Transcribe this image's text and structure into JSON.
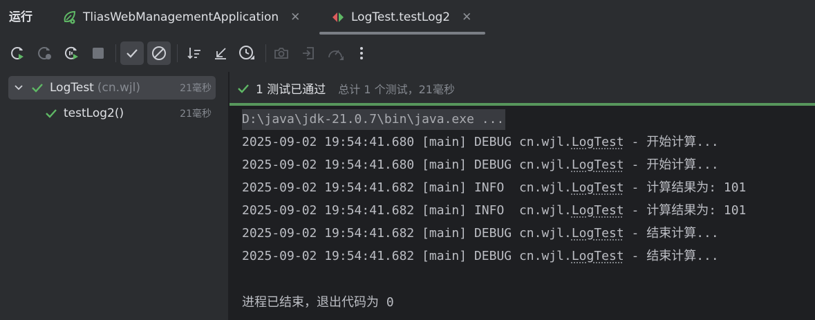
{
  "header": {
    "tool_title": "运行",
    "tabs": [
      {
        "label": "TliasWebManagementApplication",
        "icon": "spring-boot-run-icon"
      },
      {
        "label": "LogTest.testLog2",
        "icon": "junit-test-icon"
      }
    ],
    "active_tab": 1
  },
  "toolbar": {
    "buttons": [
      {
        "name": "rerun-button",
        "icon": "rerun-icon"
      },
      {
        "name": "rerun-failed-button",
        "icon": "rerun-failed-icon"
      },
      {
        "name": "toggle-auto-test-button",
        "icon": "auto-rerun-icon"
      },
      {
        "name": "stop-button",
        "icon": "stop-icon"
      },
      {
        "name": "show-passed-button",
        "icon": "check-icon",
        "active": true
      },
      {
        "name": "show-ignored-button",
        "icon": "ignored-icon",
        "active": true
      },
      {
        "name": "sort-alphabetically-button",
        "icon": "sort-icon"
      },
      {
        "name": "collapse-all-button",
        "icon": "collapse-icon"
      },
      {
        "name": "sort-by-duration-button",
        "icon": "clock-icon"
      },
      {
        "name": "screenshot-button",
        "icon": "camera-icon"
      },
      {
        "name": "import-tests-button",
        "icon": "import-icon"
      },
      {
        "name": "coverage-button",
        "icon": "gauge-icon"
      },
      {
        "name": "more-options-button",
        "icon": "more-vertical-icon"
      }
    ]
  },
  "tree": {
    "root": {
      "name": "LogTest",
      "package": "(cn.wjl)",
      "time": "21毫秒"
    },
    "children": [
      {
        "name": "testLog2()",
        "time": "21毫秒"
      }
    ]
  },
  "status": {
    "passed_text": "1 测试已通过",
    "summary_text": "总计 1 个测试，21毫秒",
    "accent_color": "#57965c"
  },
  "console": {
    "command": "D:\\java\\jdk-21.0.7\\bin\\java.exe ...",
    "logs": [
      {
        "prefix": "2025-09-02 19:54:41.680 [main] DEBUG cn.wjl.",
        "cls": "LogTest",
        "suffix": " - 开始计算..."
      },
      {
        "prefix": "2025-09-02 19:54:41.680 [main] DEBUG cn.wjl.",
        "cls": "LogTest",
        "suffix": " - 开始计算..."
      },
      {
        "prefix": "2025-09-02 19:54:41.682 [main] INFO  cn.wjl.",
        "cls": "LogTest",
        "suffix": " - 计算结果为: 101"
      },
      {
        "prefix": "2025-09-02 19:54:41.682 [main] INFO  cn.wjl.",
        "cls": "LogTest",
        "suffix": " - 计算结果为: 101"
      },
      {
        "prefix": "2025-09-02 19:54:41.682 [main] DEBUG cn.wjl.",
        "cls": "LogTest",
        "suffix": " - 结束计算..."
      },
      {
        "prefix": "2025-09-02 19:54:41.682 [main] DEBUG cn.wjl.",
        "cls": "LogTest",
        "suffix": " - 结束计算..."
      }
    ],
    "exit_message": "进程已结束，退出代码为 0"
  }
}
